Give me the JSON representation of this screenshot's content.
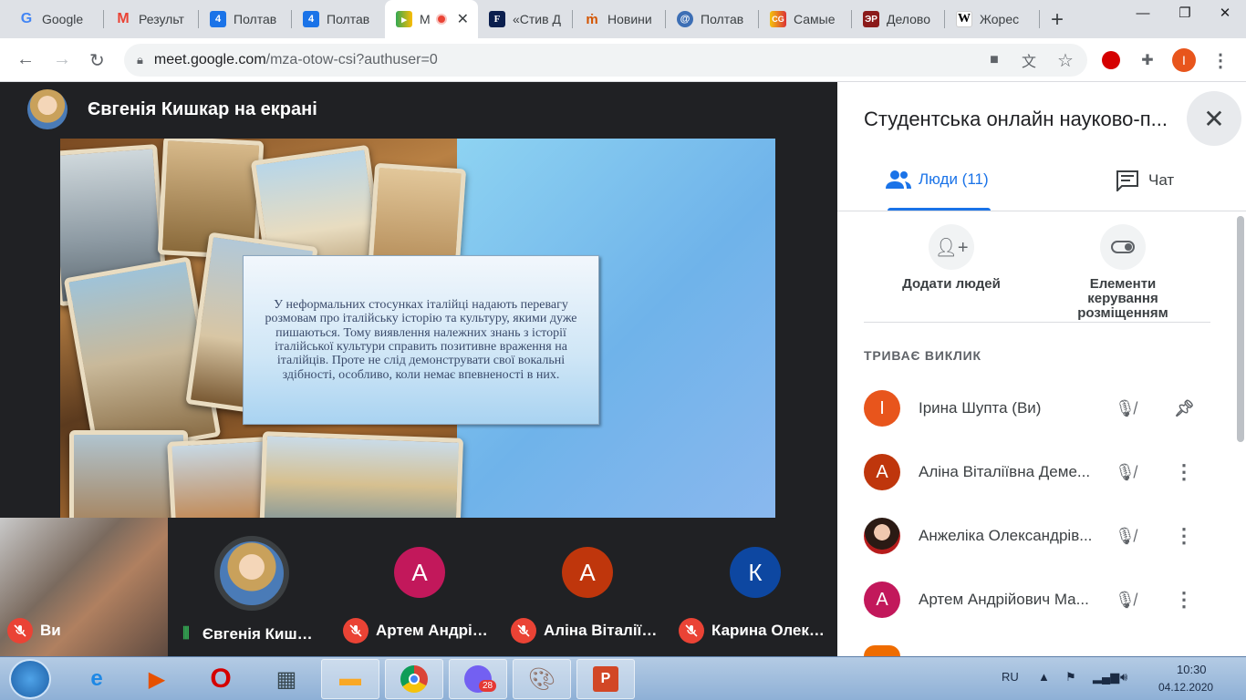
{
  "browser": {
    "tabs": [
      {
        "label": "Google",
        "icon": "google-icon"
      },
      {
        "label": "Результ",
        "icon": "gmail-icon"
      },
      {
        "label": "Полтав",
        "icon": "calendar-icon"
      },
      {
        "label": "Полтав",
        "icon": "calendar-icon"
      },
      {
        "label": "M",
        "icon": "meet-icon",
        "active": true
      },
      {
        "label": "«Стив Д",
        "icon": "forbes-icon"
      },
      {
        "label": "Новини",
        "icon": "news-icon"
      },
      {
        "label": "Полтав",
        "icon": "poltava-icon"
      },
      {
        "label": "Самые",
        "icon": "samye-icon"
      },
      {
        "label": "Делово",
        "icon": "delovoy-icon"
      },
      {
        "label": "Жорес",
        "icon": "wikipedia-icon"
      }
    ],
    "new_tab": "+",
    "url_host": "meet.google.com",
    "url_path": "/mza-otow-csi?authuser=0",
    "profile_initial": "І"
  },
  "meeting": {
    "presenter_label": "Євгенія Кишкар на екрані",
    "slide_text": "У неформальних стосунках італійці надають перевагу розмовам про італійську історію та культуру, якими дуже пишаються. Тому виявлення належних знань з історії італійської культури справить позитивне враження на італійців. Проте не слід демонструвати свої вокальні здібності, особливо, коли немає впевненості в них.",
    "tiles": [
      {
        "name": "Ви",
        "muted": true
      },
      {
        "name": "Євгенія Киш…",
        "speaking": true
      },
      {
        "name": "Артем Андрі…",
        "initial": "А",
        "color": "#c2185b",
        "muted": true
      },
      {
        "name": "Аліна Віталії…",
        "initial": "А",
        "color": "#bf360c",
        "muted": true
      },
      {
        "name": "Карина Олек…",
        "initial": "К",
        "color": "#0d47a1",
        "muted": true
      }
    ]
  },
  "panel": {
    "title": "Студентська онлайн науково-п...",
    "tab_people": "Люди (11)",
    "tab_chat": "Чат",
    "action_add": "Додати людей",
    "action_layout": "Елементи керування розміщенням",
    "section": "ТРИВАЄ ВИКЛИК",
    "participants": [
      {
        "name": "Ірина Шупта (Ви)",
        "initial": "І",
        "color": "#e8551c",
        "action": "pin-icon"
      },
      {
        "name": "Аліна Віталіївна Деме...",
        "initial": "А",
        "color": "#bf360c",
        "action": "more-icon"
      },
      {
        "name": "Анжеліка Олександрів...",
        "initial": "",
        "color": "#6d4c41",
        "action": "more-icon"
      },
      {
        "name": "Артем Андрійович Ма...",
        "initial": "А",
        "color": "#c2185b",
        "action": "more-icon"
      }
    ]
  },
  "taskbar": {
    "viber_badge": "28",
    "lang": "RU",
    "time": "10:30",
    "date": "04.12.2020"
  }
}
